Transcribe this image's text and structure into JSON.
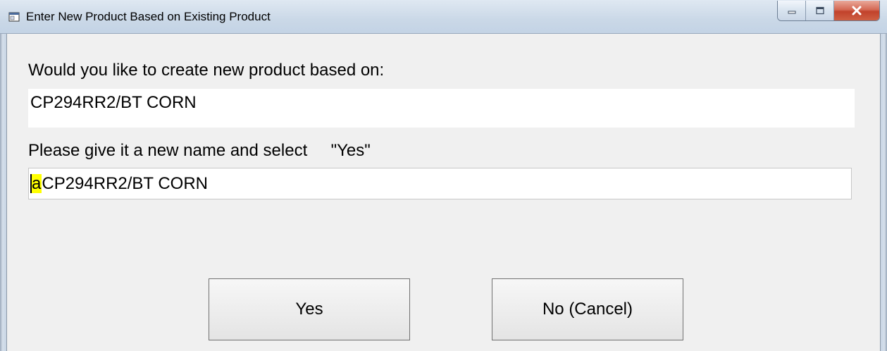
{
  "window": {
    "title": "Enter New Product Based on Existing Product"
  },
  "dialog": {
    "prompt_label": "Would you like to create new product based on:",
    "existing_product": "CP294RR2/BT CORN",
    "rename_label": "Please give it a new name and select     \"Yes\"",
    "new_name_selected": "a",
    "new_name_rest": "CP294RR2/BT CORN"
  },
  "buttons": {
    "yes_label": "Yes",
    "cancel_label": "No (Cancel)"
  },
  "colors": {
    "selection_highlight": "#ffff00",
    "close_button": "#c1422b"
  },
  "icons": {
    "app": "window-icon",
    "minimize": "minimize-icon",
    "maximize": "maximize-icon",
    "close": "close-icon"
  }
}
